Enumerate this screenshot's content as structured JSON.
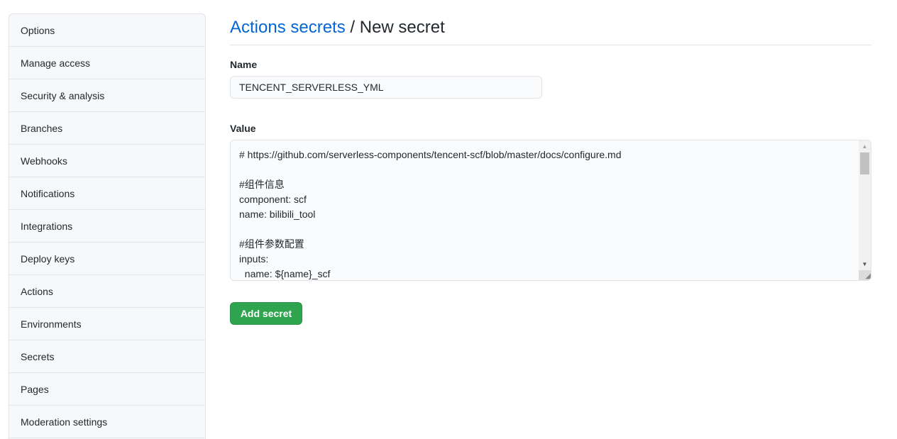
{
  "sidebar": {
    "items": [
      {
        "label": "Options"
      },
      {
        "label": "Manage access"
      },
      {
        "label": "Security & analysis"
      },
      {
        "label": "Branches"
      },
      {
        "label": "Webhooks"
      },
      {
        "label": "Notifications"
      },
      {
        "label": "Integrations"
      },
      {
        "label": "Deploy keys"
      },
      {
        "label": "Actions"
      },
      {
        "label": "Environments"
      },
      {
        "label": "Secrets"
      },
      {
        "label": "Pages"
      },
      {
        "label": "Moderation settings"
      }
    ]
  },
  "header": {
    "breadcrumb_link": "Actions secrets",
    "separator": " / ",
    "title": "New secret"
  },
  "form": {
    "name_label": "Name",
    "name_value": "TENCENT_SERVERLESS_YML",
    "value_label": "Value",
    "value_text": "# https://github.com/serverless-components/tencent-scf/blob/master/docs/configure.md\n\n#组件信息\ncomponent: scf\nname: bilibili_tool\n\n#组件参数配置\ninputs:\n  name: ${name}_scf",
    "submit_label": "Add secret"
  },
  "colors": {
    "link": "#0366d6",
    "primary_button": "#2ea44f"
  }
}
